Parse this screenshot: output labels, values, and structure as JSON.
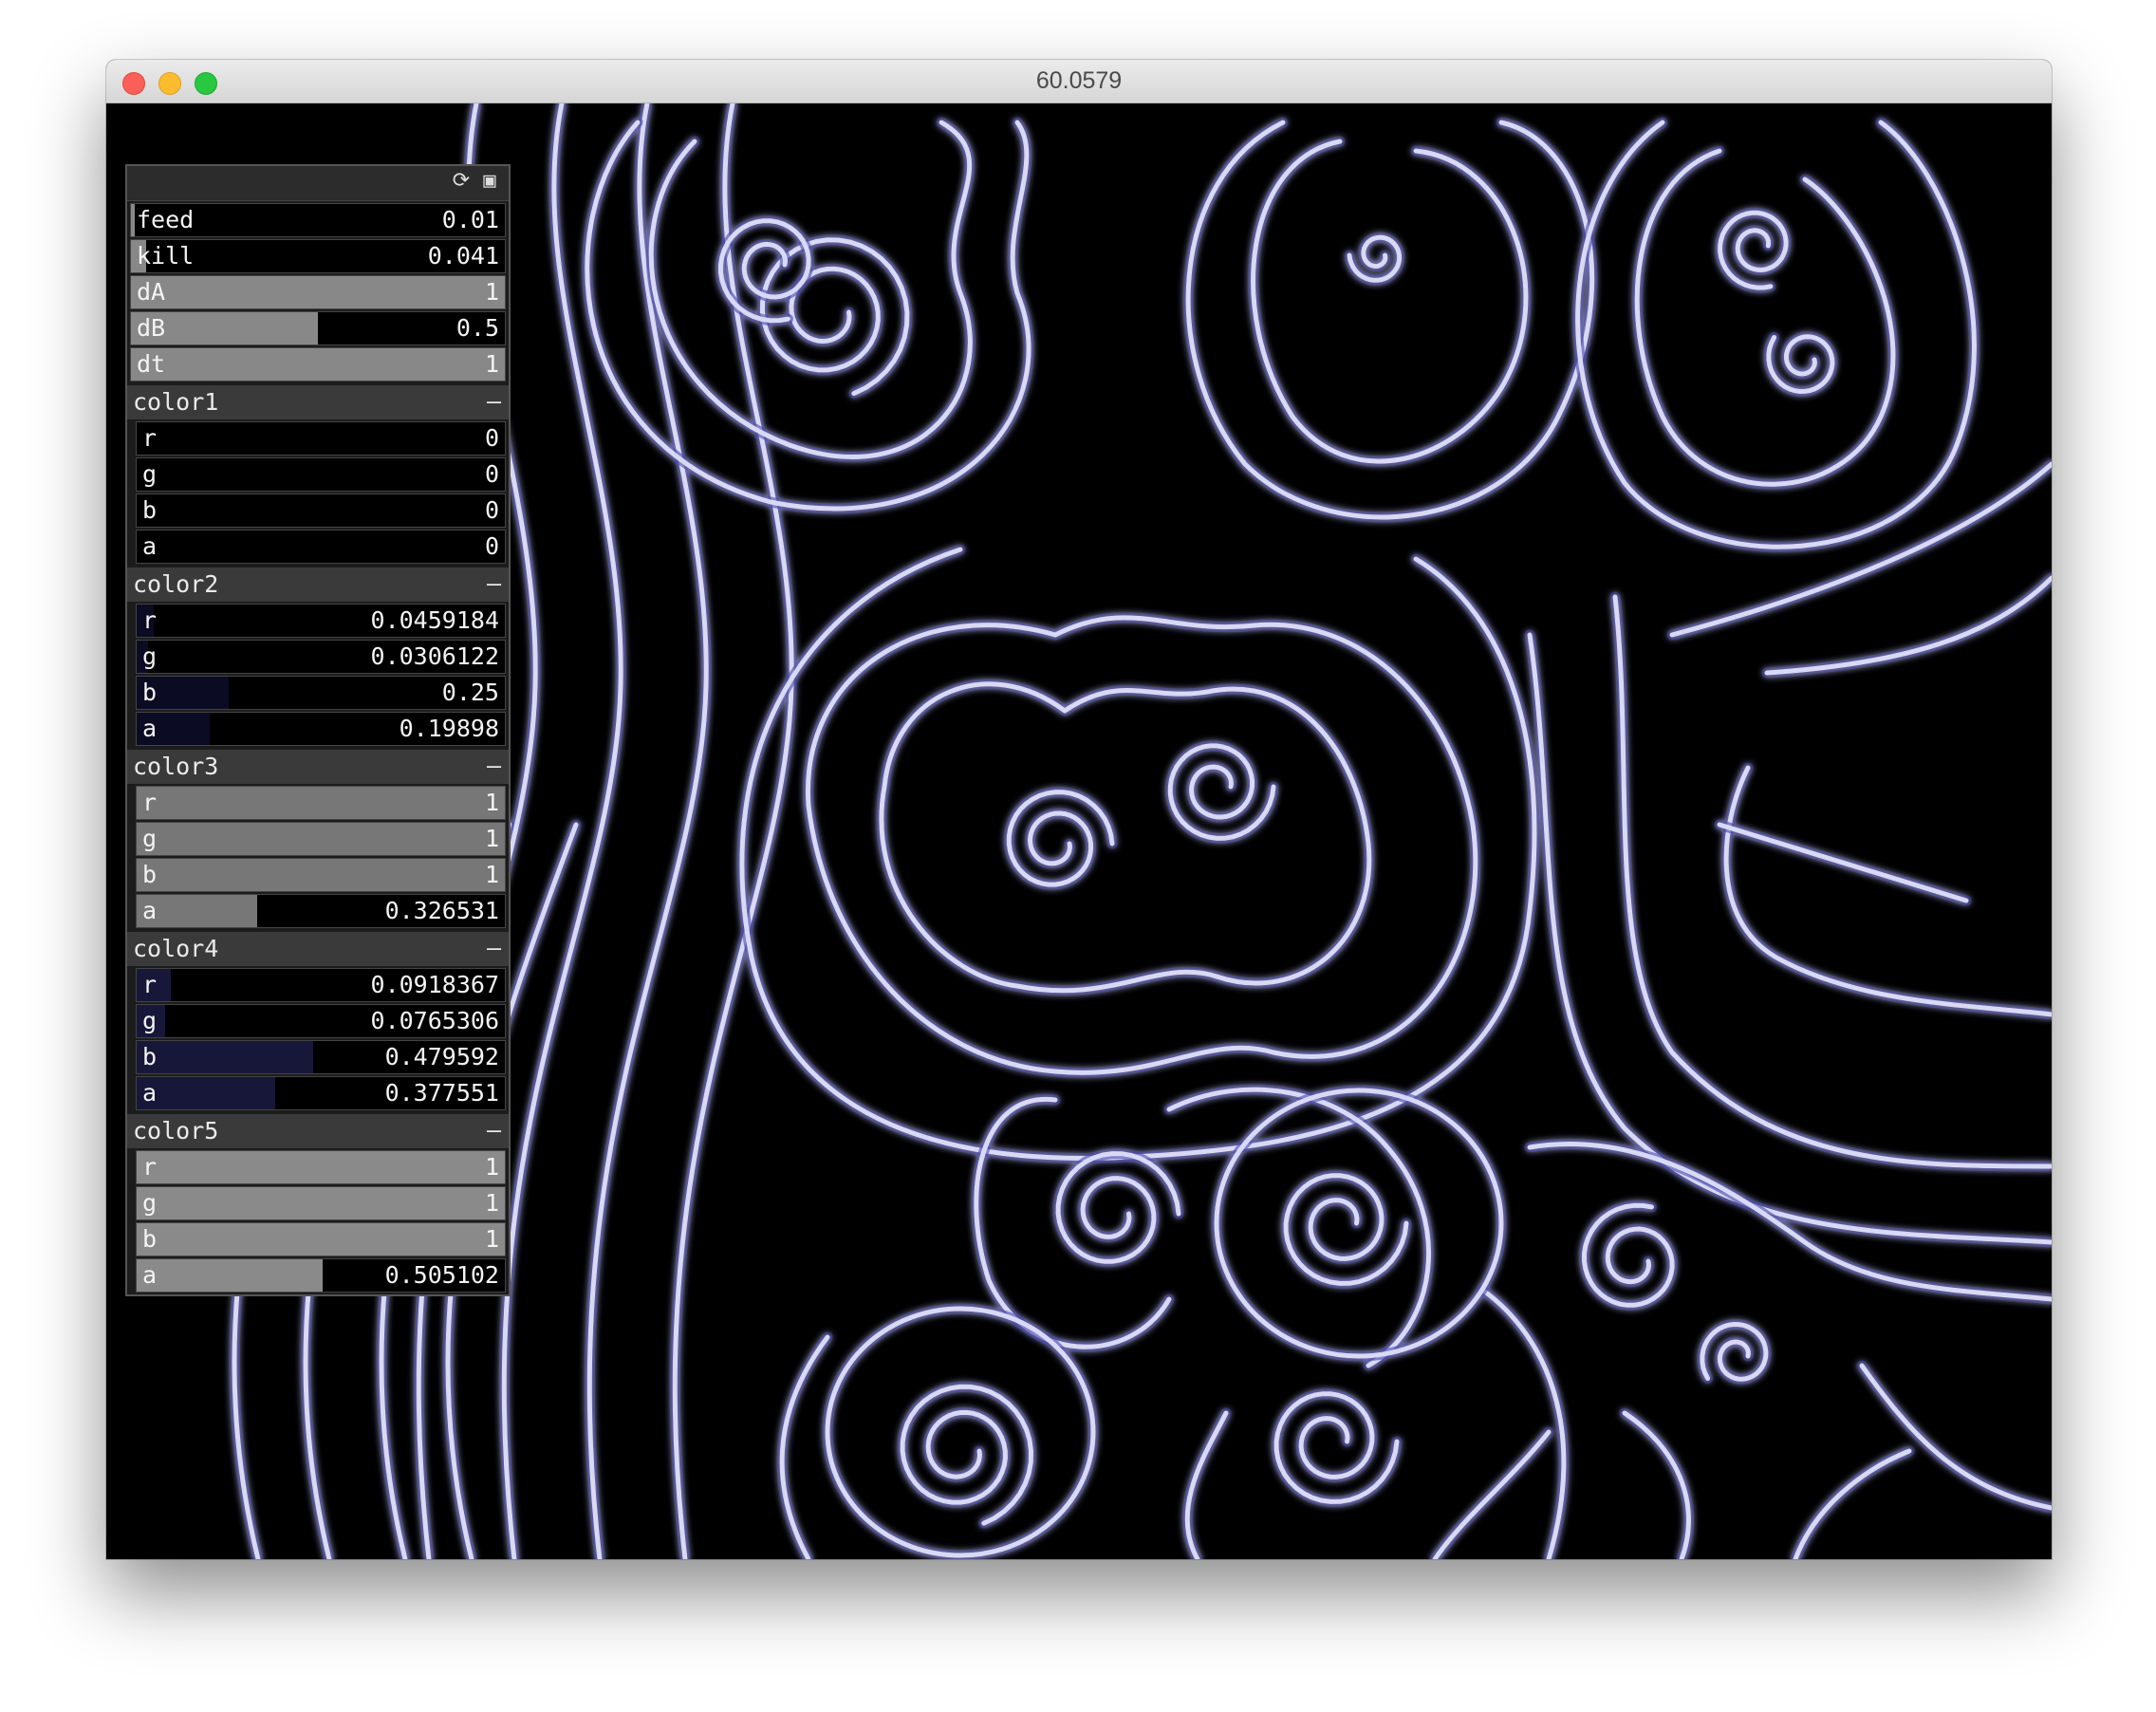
{
  "window": {
    "title": "60.0579"
  },
  "gui": {
    "params": [
      {
        "label": "feed",
        "value": "0.01",
        "fill": 0.01,
        "color": "#888888"
      },
      {
        "label": "kill",
        "value": "0.041",
        "fill": 0.041,
        "color": "#888888"
      },
      {
        "label": "dA",
        "value": "1",
        "fill": 1,
        "color": "#888888"
      },
      {
        "label": "dB",
        "value": "0.5",
        "fill": 0.5,
        "color": "#888888"
      },
      {
        "label": "dt",
        "value": "1",
        "fill": 1,
        "color": "#888888"
      }
    ],
    "groups": [
      {
        "name": "color1",
        "toggle": "–",
        "channels": [
          {
            "label": "r",
            "value": "0",
            "fill": 0,
            "color": "#0b0b24"
          },
          {
            "label": "g",
            "value": "0",
            "fill": 0,
            "color": "#0b0b24"
          },
          {
            "label": "b",
            "value": "0",
            "fill": 0,
            "color": "#0b0b24"
          },
          {
            "label": "a",
            "value": "0",
            "fill": 0,
            "color": "#0b0b24"
          }
        ]
      },
      {
        "name": "color2",
        "toggle": "–",
        "channels": [
          {
            "label": "r",
            "value": "0.0459184",
            "fill": 0.0459184,
            "color": "#0b0b24"
          },
          {
            "label": "g",
            "value": "0.0306122",
            "fill": 0.0306122,
            "color": "#0b0b24"
          },
          {
            "label": "b",
            "value": "0.25",
            "fill": 0.25,
            "color": "#0b0b24"
          },
          {
            "label": "a",
            "value": "0.19898",
            "fill": 0.19898,
            "color": "#0b0b24"
          }
        ]
      },
      {
        "name": "color3",
        "toggle": "–",
        "channels": [
          {
            "label": "r",
            "value": "1",
            "fill": 1,
            "color": "#777777"
          },
          {
            "label": "g",
            "value": "1",
            "fill": 1,
            "color": "#777777"
          },
          {
            "label": "b",
            "value": "1",
            "fill": 1,
            "color": "#777777"
          },
          {
            "label": "a",
            "value": "0.326531",
            "fill": 0.326531,
            "color": "#777777"
          }
        ]
      },
      {
        "name": "color4",
        "toggle": "–",
        "channels": [
          {
            "label": "r",
            "value": "0.0918367",
            "fill": 0.0918367,
            "color": "#17173a"
          },
          {
            "label": "g",
            "value": "0.0765306",
            "fill": 0.0765306,
            "color": "#17173a"
          },
          {
            "label": "b",
            "value": "0.479592",
            "fill": 0.479592,
            "color": "#17173a"
          },
          {
            "label": "a",
            "value": "0.377551",
            "fill": 0.377551,
            "color": "#17173a"
          }
        ]
      },
      {
        "name": "color5",
        "toggle": "–",
        "channels": [
          {
            "label": "r",
            "value": "1",
            "fill": 1,
            "color": "#8a8a8a"
          },
          {
            "label": "g",
            "value": "1",
            "fill": 1,
            "color": "#8a8a8a"
          },
          {
            "label": "b",
            "value": "1",
            "fill": 1,
            "color": "#8a8a8a"
          },
          {
            "label": "a",
            "value": "0.505102",
            "fill": 0.505102,
            "color": "#8a8a8a"
          }
        ]
      }
    ],
    "icons": [
      "refresh-icon",
      "save-icon"
    ]
  },
  "colors": {
    "background": "#000000",
    "stripe": "#d9d9f5",
    "stripe_glow": "#3a3aa8"
  }
}
